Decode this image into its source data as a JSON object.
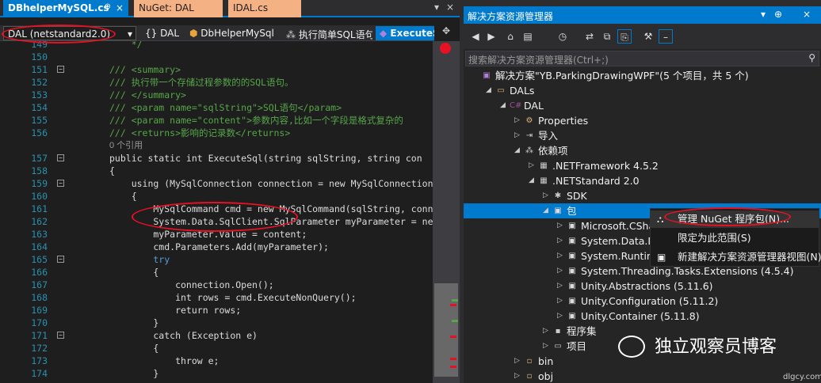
{
  "editor": {
    "tabs": [
      {
        "label": "DBhelperMySQL.cs",
        "pin": "⊕",
        "close": "×"
      },
      {
        "label": "NuGet: DAL"
      },
      {
        "label": "IDAL.cs"
      }
    ],
    "tab_dropdown": "▾",
    "tab_close": "×",
    "nav": {
      "project": "DAL (netstandard2.0)",
      "namespace": "{} DAL",
      "class": "DbHelperMySql",
      "member": "执行简单SQL语句",
      "method": "ExecuteS"
    },
    "lines": [
      {
        "n": "149",
        "t": "    */",
        "c": "cm"
      },
      {
        "n": "150",
        "t": "",
        "c": "cm"
      },
      {
        "n": "151",
        "t": "/// <summary>",
        "c": "cm",
        "fold": "−"
      },
      {
        "n": "152",
        "t": "/// 执行带一个存储过程参数的的SQL语句。",
        "c": "cm"
      },
      {
        "n": "153",
        "t": "/// </summary>",
        "c": "cm"
      },
      {
        "n": "154",
        "t": "/// <param name=\"sqlString\">SQL语句</param>",
        "c": "cm"
      },
      {
        "n": "155",
        "t": "/// <param name=\"content\">参数内容,比如一个字段是格式复杂的",
        "c": "cm"
      },
      {
        "n": "156",
        "t": "/// <returns>影响的记录数</returns>",
        "c": "cm"
      },
      {
        "n": "",
        "t": "0 个引用",
        "c": "ref"
      },
      {
        "n": "157",
        "t": "public static int ExecuteSql(string sqlString, string con",
        "c": "df",
        "fold": "−"
      },
      {
        "n": "158",
        "t": "{",
        "c": "df"
      },
      {
        "n": "159",
        "t": "    using (MySqlConnection connection = new MySqlConnection",
        "c": "df",
        "fold": "−"
      },
      {
        "n": "160",
        "t": "    {",
        "c": "df"
      },
      {
        "n": "161",
        "t": "        MySqlCommand cmd = new MySqlCommand(sqlString, conn",
        "c": "df"
      },
      {
        "n": "162",
        "t": "        System.Data.SqlClient.SqlParameter myParameter = ne",
        "c": "df"
      },
      {
        "n": "163",
        "t": "        myParameter.Value = content;",
        "c": "df"
      },
      {
        "n": "164",
        "t": "        cmd.Parameters.Add(myParameter);",
        "c": "df"
      },
      {
        "n": "165",
        "t": "        try",
        "c": "kw",
        "fold": "−"
      },
      {
        "n": "166",
        "t": "        {",
        "c": "df"
      },
      {
        "n": "167",
        "t": "            connection.Open();",
        "c": "df"
      },
      {
        "n": "168",
        "t": "            int rows = cmd.ExecuteNonQuery();",
        "c": "df"
      },
      {
        "n": "169",
        "t": "            return rows;",
        "c": "df"
      },
      {
        "n": "170",
        "t": "        }",
        "c": "df"
      },
      {
        "n": "171",
        "t": "        catch (Exception e)",
        "c": "df",
        "fold": "−"
      },
      {
        "n": "172",
        "t": "        {",
        "c": "df"
      },
      {
        "n": "173",
        "t": "            throw e;",
        "c": "df"
      },
      {
        "n": "174",
        "t": "        }",
        "c": "df"
      }
    ]
  },
  "solution_explorer": {
    "title": "解决方案资源管理器",
    "title_controls": [
      "▾",
      "⊕",
      "×"
    ],
    "search_placeholder": "搜索解决方案资源管理器(Ctrl+;)",
    "search_icon": "⚲",
    "tree": [
      {
        "label": "解决方案\"YB.ParkingDrawingWPF\"(5 个项目，共 5 个)",
        "level": 0,
        "exp": "",
        "icon": "solution-icon",
        "glyph": "▣"
      },
      {
        "label": "DALs",
        "level": 1,
        "exp": "◢",
        "icon": "folder-icon",
        "glyph": "▭"
      },
      {
        "label": "DAL",
        "level": 2,
        "exp": "◢",
        "icon": "csharp-project-icon",
        "glyph": "C#"
      },
      {
        "label": "Properties",
        "level": 3,
        "exp": "▷",
        "icon": "wrench-icon",
        "glyph": "⚙"
      },
      {
        "label": "导入",
        "level": 3,
        "exp": "▷",
        "icon": "import-icon",
        "glyph": "⇥"
      },
      {
        "label": "依赖项",
        "level": 3,
        "exp": "◢",
        "icon": "dependencies-icon",
        "glyph": "⁂"
      },
      {
        "label": ".NETFramework 4.5.2",
        "level": 4,
        "exp": "▷",
        "icon": "framework-icon",
        "glyph": "▦"
      },
      {
        "label": ".NETStandard 2.0",
        "level": 4,
        "exp": "◢",
        "icon": "framework-icon",
        "glyph": "▦"
      },
      {
        "label": "SDK",
        "level": 5,
        "exp": "▷",
        "icon": "sdk-icon",
        "glyph": "✱"
      },
      {
        "label": "包",
        "level": 5,
        "exp": "◢",
        "icon": "package-icon",
        "glyph": "▣",
        "selected": true
      },
      {
        "label": "Microsoft.CShar",
        "level": 6,
        "exp": "▷",
        "icon": "package-icon",
        "glyph": "▣"
      },
      {
        "label": "System.Data.Dat",
        "level": 6,
        "exp": "▷",
        "icon": "package-icon",
        "glyph": "▣"
      },
      {
        "label": "System.Runtime.",
        "level": 6,
        "exp": "▷",
        "icon": "package-icon",
        "glyph": "▣"
      },
      {
        "label": "System.Threading.Tasks.Extensions (4.5.4)",
        "level": 6,
        "exp": "▷",
        "icon": "package-icon",
        "glyph": "▣"
      },
      {
        "label": "Unity.Abstractions (5.11.6)",
        "level": 6,
        "exp": "▷",
        "icon": "package-icon",
        "glyph": "▣"
      },
      {
        "label": "Unity.Configuration (5.11.2)",
        "level": 6,
        "exp": "▷",
        "icon": "package-icon",
        "glyph": "▣"
      },
      {
        "label": "Unity.Container (5.11.8)",
        "level": 6,
        "exp": "▷",
        "icon": "package-icon",
        "glyph": "▣"
      },
      {
        "label": "程序集",
        "level": 5,
        "exp": "▷",
        "icon": "assembly-icon",
        "glyph": "▪"
      },
      {
        "label": "项目",
        "level": 5,
        "exp": "▷",
        "icon": "project-ref-icon",
        "glyph": "▭"
      },
      {
        "label": "bin",
        "level": 3,
        "exp": "▷",
        "icon": "folder-icon",
        "glyph": "▫"
      },
      {
        "label": "obj",
        "level": 3,
        "exp": "▷",
        "icon": "folder-icon",
        "glyph": "▫"
      }
    ]
  },
  "context_menu": {
    "items": [
      {
        "label": "管理 NuGet 程序包(N)...",
        "icon": "nuget-icon",
        "glyph": "⛬"
      },
      {
        "label": "限定为此范围(S)",
        "icon": "",
        "glyph": ""
      },
      {
        "label": "新建解决方案资源管理器视图(N)",
        "icon": "new-view-icon",
        "glyph": "▣"
      }
    ]
  },
  "watermark": {
    "text": "独立观察员博客",
    "url": "dlgcy.com"
  },
  "colors": {
    "accent": "#007acc",
    "annotation": "#e81123",
    "comment": "#57a64a",
    "keyword": "#569cd6",
    "type": "#4ec9b0",
    "line_number": "#2b91af"
  }
}
